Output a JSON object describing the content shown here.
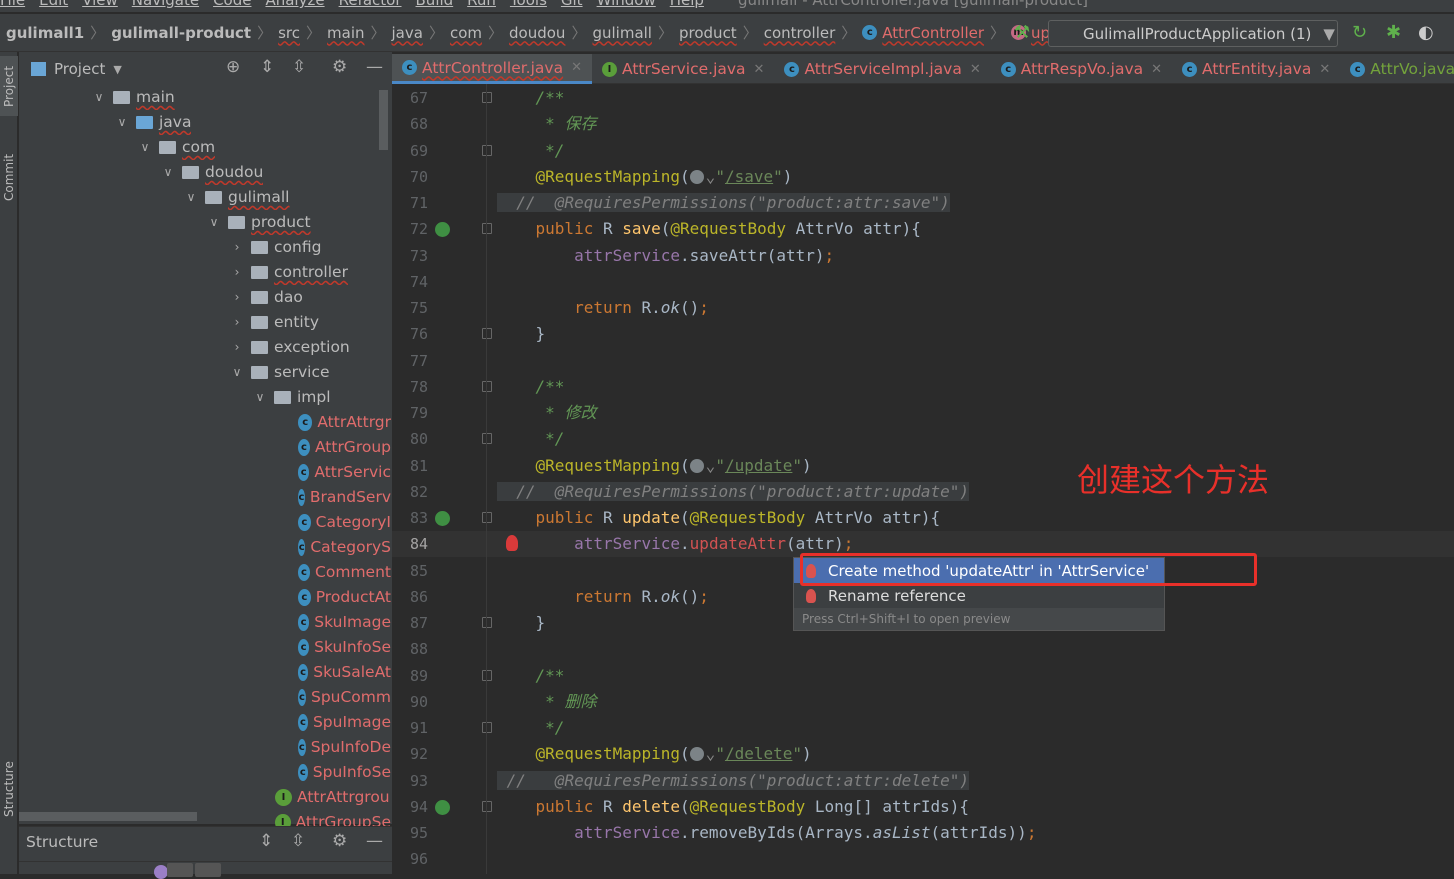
{
  "menu": {
    "items": [
      "File",
      "Edit",
      "View",
      "Navigate",
      "Code",
      "Analyze",
      "Refactor",
      "Build",
      "Run",
      "Tools",
      "Git",
      "Window",
      "Help"
    ],
    "window_title": "gulimall - AttrController.java [gulimall-product]"
  },
  "breadcrumb": [
    {
      "label": "gulimall1",
      "style": "bold"
    },
    {
      "label": "gulimall-product",
      "style": "bold"
    },
    {
      "label": "src"
    },
    {
      "label": "main"
    },
    {
      "label": "java"
    },
    {
      "label": "com"
    },
    {
      "label": "doudou"
    },
    {
      "label": "gulimall"
    },
    {
      "label": "product"
    },
    {
      "label": "controller"
    },
    {
      "label": "AttrController",
      "icon": "c",
      "style": "red"
    },
    {
      "label": "update",
      "icon": "m",
      "style": "red"
    }
  ],
  "run_config": {
    "label": "GulimallProductApplication (1)"
  },
  "side_tabs": {
    "project": "Project",
    "commit": "Commit",
    "structure": "Structure"
  },
  "project_panel": {
    "title": "Project",
    "tree": [
      {
        "label": "main",
        "depth": 0,
        "type": "folder",
        "state": "open"
      },
      {
        "label": "java",
        "depth": 1,
        "type": "folder-blue",
        "state": "open"
      },
      {
        "label": "com",
        "depth": 2,
        "type": "folder",
        "state": "open"
      },
      {
        "label": "doudou",
        "depth": 3,
        "type": "folder",
        "state": "open"
      },
      {
        "label": "gulimall",
        "depth": 4,
        "type": "folder",
        "state": "open"
      },
      {
        "label": "product",
        "depth": 5,
        "type": "folder",
        "state": "open"
      },
      {
        "label": "config",
        "depth": 6,
        "type": "folder",
        "state": "closed"
      },
      {
        "label": "controller",
        "depth": 6,
        "type": "folder",
        "state": "closed"
      },
      {
        "label": "dao",
        "depth": 6,
        "type": "folder",
        "state": "closed"
      },
      {
        "label": "entity",
        "depth": 6,
        "type": "folder",
        "state": "closed"
      },
      {
        "label": "exception",
        "depth": 6,
        "type": "folder",
        "state": "closed"
      },
      {
        "label": "service",
        "depth": 6,
        "type": "folder",
        "state": "open"
      },
      {
        "label": "impl",
        "depth": 7,
        "type": "folder",
        "state": "open"
      },
      {
        "label": "AttrAttrgr",
        "depth": 8,
        "type": "class"
      },
      {
        "label": "AttrGroup",
        "depth": 8,
        "type": "class"
      },
      {
        "label": "AttrServic",
        "depth": 8,
        "type": "class"
      },
      {
        "label": "BrandServ",
        "depth": 8,
        "type": "class"
      },
      {
        "label": "CategoryI",
        "depth": 8,
        "type": "class"
      },
      {
        "label": "CategoryS",
        "depth": 8,
        "type": "class"
      },
      {
        "label": "Comment",
        "depth": 8,
        "type": "class"
      },
      {
        "label": "ProductAt",
        "depth": 8,
        "type": "class"
      },
      {
        "label": "SkuImage",
        "depth": 8,
        "type": "class"
      },
      {
        "label": "SkuInfoSe",
        "depth": 8,
        "type": "class"
      },
      {
        "label": "SkuSaleAt",
        "depth": 8,
        "type": "class"
      },
      {
        "label": "SpuComm",
        "depth": 8,
        "type": "class"
      },
      {
        "label": "SpuImage",
        "depth": 8,
        "type": "class"
      },
      {
        "label": "SpuInfoDe",
        "depth": 8,
        "type": "class"
      },
      {
        "label": "SpuInfoSe",
        "depth": 8,
        "type": "class"
      },
      {
        "label": "AttrAttrgrou",
        "depth": 7,
        "type": "interface"
      },
      {
        "label": "AttrGroupSe",
        "depth": 7,
        "type": "interface"
      }
    ]
  },
  "structure_panel": {
    "title": "Structure"
  },
  "tabs": [
    {
      "label": "AttrController.java",
      "icon": "c",
      "active": true
    },
    {
      "label": "AttrService.java",
      "icon": "i"
    },
    {
      "label": "AttrServiceImpl.java",
      "icon": "c"
    },
    {
      "label": "AttrRespVo.java",
      "icon": "c"
    },
    {
      "label": "AttrEntity.java",
      "icon": "c"
    },
    {
      "label": "AttrVo.java",
      "icon": "c",
      "color": "green"
    }
  ],
  "editor": {
    "lines": [
      {
        "n": 67,
        "t": [
          [
            "pl",
            "    "
          ],
          [
            "cmt",
            "/**"
          ]
        ]
      },
      {
        "n": 68,
        "t": [
          [
            "pl",
            "     "
          ],
          [
            "cmt",
            "* 保存"
          ]
        ]
      },
      {
        "n": 69,
        "t": [
          [
            "pl",
            "     "
          ],
          [
            "cmt",
            "*/"
          ]
        ]
      },
      {
        "n": 70,
        "t": [
          [
            "pl",
            "    "
          ],
          [
            "ann",
            "@RequestMapping"
          ],
          [
            "pl",
            "("
          ],
          [
            "globe",
            ""
          ],
          [
            "str",
            "\""
          ],
          [
            "str ul2",
            "/save"
          ],
          [
            "str",
            "\""
          ],
          [
            "pl",
            ")"
          ]
        ]
      },
      {
        "n": 71,
        "hl": true,
        "t": [
          [
            "pl",
            "  "
          ],
          [
            "lcmt",
            "//  @RequiresPermissions(\"product:attr:save\")"
          ]
        ]
      },
      {
        "n": 72,
        "run": true,
        "t": [
          [
            "pl",
            "    "
          ],
          [
            "kw",
            "public "
          ],
          [
            "pl",
            "R "
          ],
          [
            "fn",
            "save"
          ],
          [
            "pl",
            "("
          ],
          [
            "ann",
            "@RequestBody "
          ],
          [
            "pl",
            "AttrVo attr){"
          ]
        ]
      },
      {
        "n": 73,
        "t": [
          [
            "pl",
            "        "
          ],
          [
            "fld",
            "attrService"
          ],
          [
            "pl",
            ".saveAttr(attr)"
          ],
          [
            "kw",
            ";"
          ]
        ]
      },
      {
        "n": 74,
        "t": []
      },
      {
        "n": 75,
        "t": [
          [
            "pl",
            "        "
          ],
          [
            "kw",
            "return "
          ],
          [
            "pl",
            "R."
          ],
          [
            "it",
            "ok"
          ],
          [
            "pl",
            "()"
          ],
          [
            "kw",
            ";"
          ]
        ]
      },
      {
        "n": 76,
        "t": [
          [
            "pl",
            "    }"
          ]
        ]
      },
      {
        "n": 77,
        "t": []
      },
      {
        "n": 78,
        "t": [
          [
            "pl",
            "    "
          ],
          [
            "cmt",
            "/**"
          ]
        ]
      },
      {
        "n": 79,
        "t": [
          [
            "pl",
            "     "
          ],
          [
            "cmt",
            "* 修改"
          ]
        ]
      },
      {
        "n": 80,
        "t": [
          [
            "pl",
            "     "
          ],
          [
            "cmt",
            "*/"
          ]
        ]
      },
      {
        "n": 81,
        "t": [
          [
            "pl",
            "    "
          ],
          [
            "ann",
            "@RequestMapping"
          ],
          [
            "pl",
            "("
          ],
          [
            "globe",
            ""
          ],
          [
            "str",
            "\""
          ],
          [
            "str ul2",
            "/update"
          ],
          [
            "str",
            "\""
          ],
          [
            "pl",
            ")"
          ]
        ]
      },
      {
        "n": 82,
        "hl": true,
        "t": [
          [
            "pl",
            "  "
          ],
          [
            "lcmt",
            "//  @RequiresPermissions(\"product:attr:update\")"
          ]
        ]
      },
      {
        "n": 83,
        "run": true,
        "t": [
          [
            "pl",
            "    "
          ],
          [
            "kw",
            "public "
          ],
          [
            "pl",
            "R "
          ],
          [
            "fn",
            "update"
          ],
          [
            "pl",
            "("
          ],
          [
            "ann",
            "@RequestBody "
          ],
          [
            "pl",
            "AttrVo attr){"
          ]
        ]
      },
      {
        "n": 84,
        "current": true,
        "bulb": true,
        "t": [
          [
            "pl",
            "        "
          ],
          [
            "fld",
            "attrService"
          ],
          [
            "pl",
            "."
          ],
          [
            "err",
            "updateAttr"
          ],
          [
            "pl",
            "(attr)"
          ],
          [
            "kw",
            ";"
          ]
        ]
      },
      {
        "n": 85,
        "t": []
      },
      {
        "n": 86,
        "t": [
          [
            "pl",
            "        "
          ],
          [
            "kw",
            "return "
          ],
          [
            "pl",
            "R."
          ],
          [
            "it",
            "ok"
          ],
          [
            "pl",
            "()"
          ],
          [
            "kw",
            ";"
          ]
        ]
      },
      {
        "n": 87,
        "t": [
          [
            "pl",
            "    }"
          ]
        ]
      },
      {
        "n": 88,
        "t": []
      },
      {
        "n": 89,
        "t": [
          [
            "pl",
            "    "
          ],
          [
            "cmt",
            "/**"
          ]
        ]
      },
      {
        "n": 90,
        "t": [
          [
            "pl",
            "     "
          ],
          [
            "cmt",
            "* 删除"
          ]
        ]
      },
      {
        "n": 91,
        "t": [
          [
            "pl",
            "     "
          ],
          [
            "cmt",
            "*/"
          ]
        ]
      },
      {
        "n": 92,
        "t": [
          [
            "pl",
            "    "
          ],
          [
            "ann",
            "@RequestMapping"
          ],
          [
            "pl",
            "("
          ],
          [
            "globe",
            ""
          ],
          [
            "str",
            "\""
          ],
          [
            "str ul2",
            "/delete"
          ],
          [
            "str",
            "\""
          ],
          [
            "pl",
            ")"
          ]
        ]
      },
      {
        "n": 93,
        "hl": true,
        "t": [
          [
            "pl",
            " "
          ],
          [
            "lcmt",
            "//   @RequiresPermissions(\"product:attr:delete\")"
          ]
        ]
      },
      {
        "n": 94,
        "run": true,
        "t": [
          [
            "pl",
            "    "
          ],
          [
            "kw",
            "public "
          ],
          [
            "pl",
            "R "
          ],
          [
            "fn",
            "delete"
          ],
          [
            "pl",
            "("
          ],
          [
            "ann",
            "@RequestBody "
          ],
          [
            "pl",
            "Long[] attrIds){"
          ]
        ]
      },
      {
        "n": 95,
        "t": [
          [
            "pl",
            "        "
          ],
          [
            "fld",
            "attrService"
          ],
          [
            "pl",
            ".removeByIds(Arrays."
          ],
          [
            "it",
            "asList"
          ],
          [
            "pl",
            "(attrIds))"
          ],
          [
            "kw",
            ";"
          ]
        ]
      },
      {
        "n": 96,
        "t": []
      }
    ]
  },
  "intention_popup": {
    "items": [
      {
        "label": "Create method 'updateAttr' in 'AttrService'",
        "selected": true
      },
      {
        "label": "Rename reference"
      }
    ],
    "footer": "Press Ctrl+Shift+I to open preview"
  },
  "annotation": {
    "text": "创建这个方法",
    "color": "#e8302a"
  },
  "colors": {
    "accent": "#4b6eaf",
    "error": "#d25252",
    "annotation": "#e8302a"
  }
}
